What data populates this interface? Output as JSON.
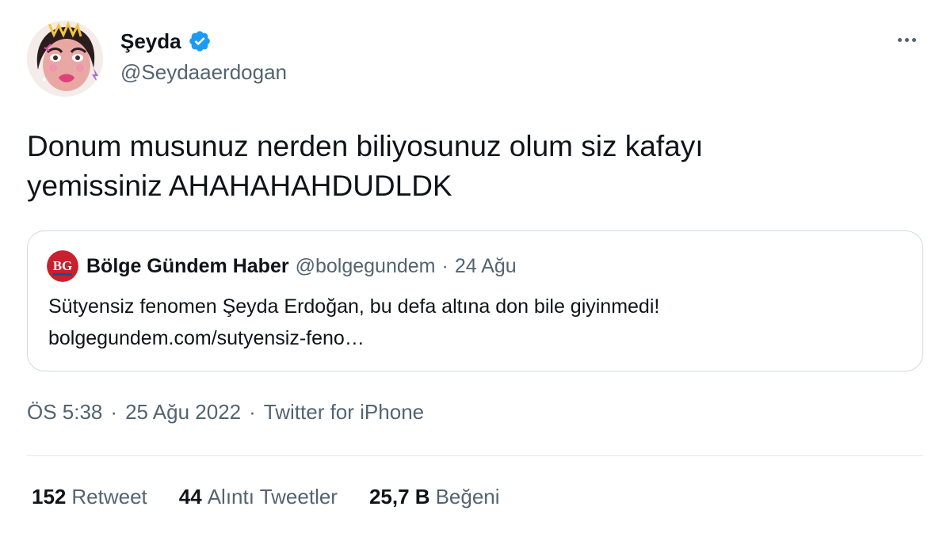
{
  "author": {
    "display_name": "Şeyda",
    "handle": "@Seydaaerdogan",
    "verified": true,
    "avatar": "cartoon-avatar"
  },
  "tweet": {
    "text_line1": "Donum musunuz nerden biliyosunuz olum siz kafayı",
    "text_line2": "yemissiniz AHAHAHAHDUDLDK"
  },
  "quote": {
    "logo_text": "BG",
    "name": "Bölge Gündem Haber",
    "handle": "@bolgegundem",
    "separator": "·",
    "date": "24 Ağu",
    "text": "Sütyensiz fenomen Şeyda Erdoğan, bu defa altına don bile giyinmedi!",
    "link": "bolgegundem.com/sutyensiz-feno…"
  },
  "meta": {
    "time": "ÖS 5:38",
    "separator": "·",
    "date": "25 Ağu 2022",
    "source": "Twitter for iPhone"
  },
  "stats": {
    "retweets_num": "152",
    "retweets_label": "Retweet",
    "quotes_num": "44",
    "quotes_label": "Alıntı Tweetler",
    "likes_num": "25,7 B",
    "likes_label": "Beğeni"
  },
  "colors": {
    "text": "#0f1419",
    "secondary": "#536471",
    "verified": "#1d9bf0",
    "border": "#cfd9de",
    "logo_red": "#c8202f"
  }
}
